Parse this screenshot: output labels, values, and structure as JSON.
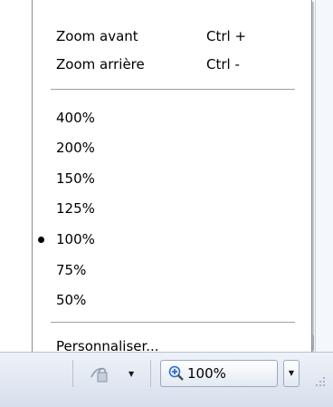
{
  "menu": {
    "zoom_in": {
      "label": "Zoom avant",
      "shortcut": "Ctrl +"
    },
    "zoom_out": {
      "label": "Zoom arrière",
      "shortcut": "Ctrl -"
    },
    "levels": [
      {
        "label": "400%",
        "selected": false
      },
      {
        "label": "200%",
        "selected": false
      },
      {
        "label": "150%",
        "selected": false
      },
      {
        "label": "125%",
        "selected": false
      },
      {
        "label": "100%",
        "selected": true
      },
      {
        "label": "75%",
        "selected": false
      },
      {
        "label": "50%",
        "selected": false
      }
    ],
    "custom": {
      "label": "Personnaliser..."
    }
  },
  "statusbar": {
    "security_icon": "page-security-icon",
    "zoom": {
      "icon": "magnifier-plus-icon",
      "label": "100%"
    }
  },
  "colors": {
    "menu_border": "#8c8c8c",
    "separator": "#a0a0a0",
    "statusbar_top": "#eef2f8",
    "statusbar_bottom": "#d7dfec"
  }
}
